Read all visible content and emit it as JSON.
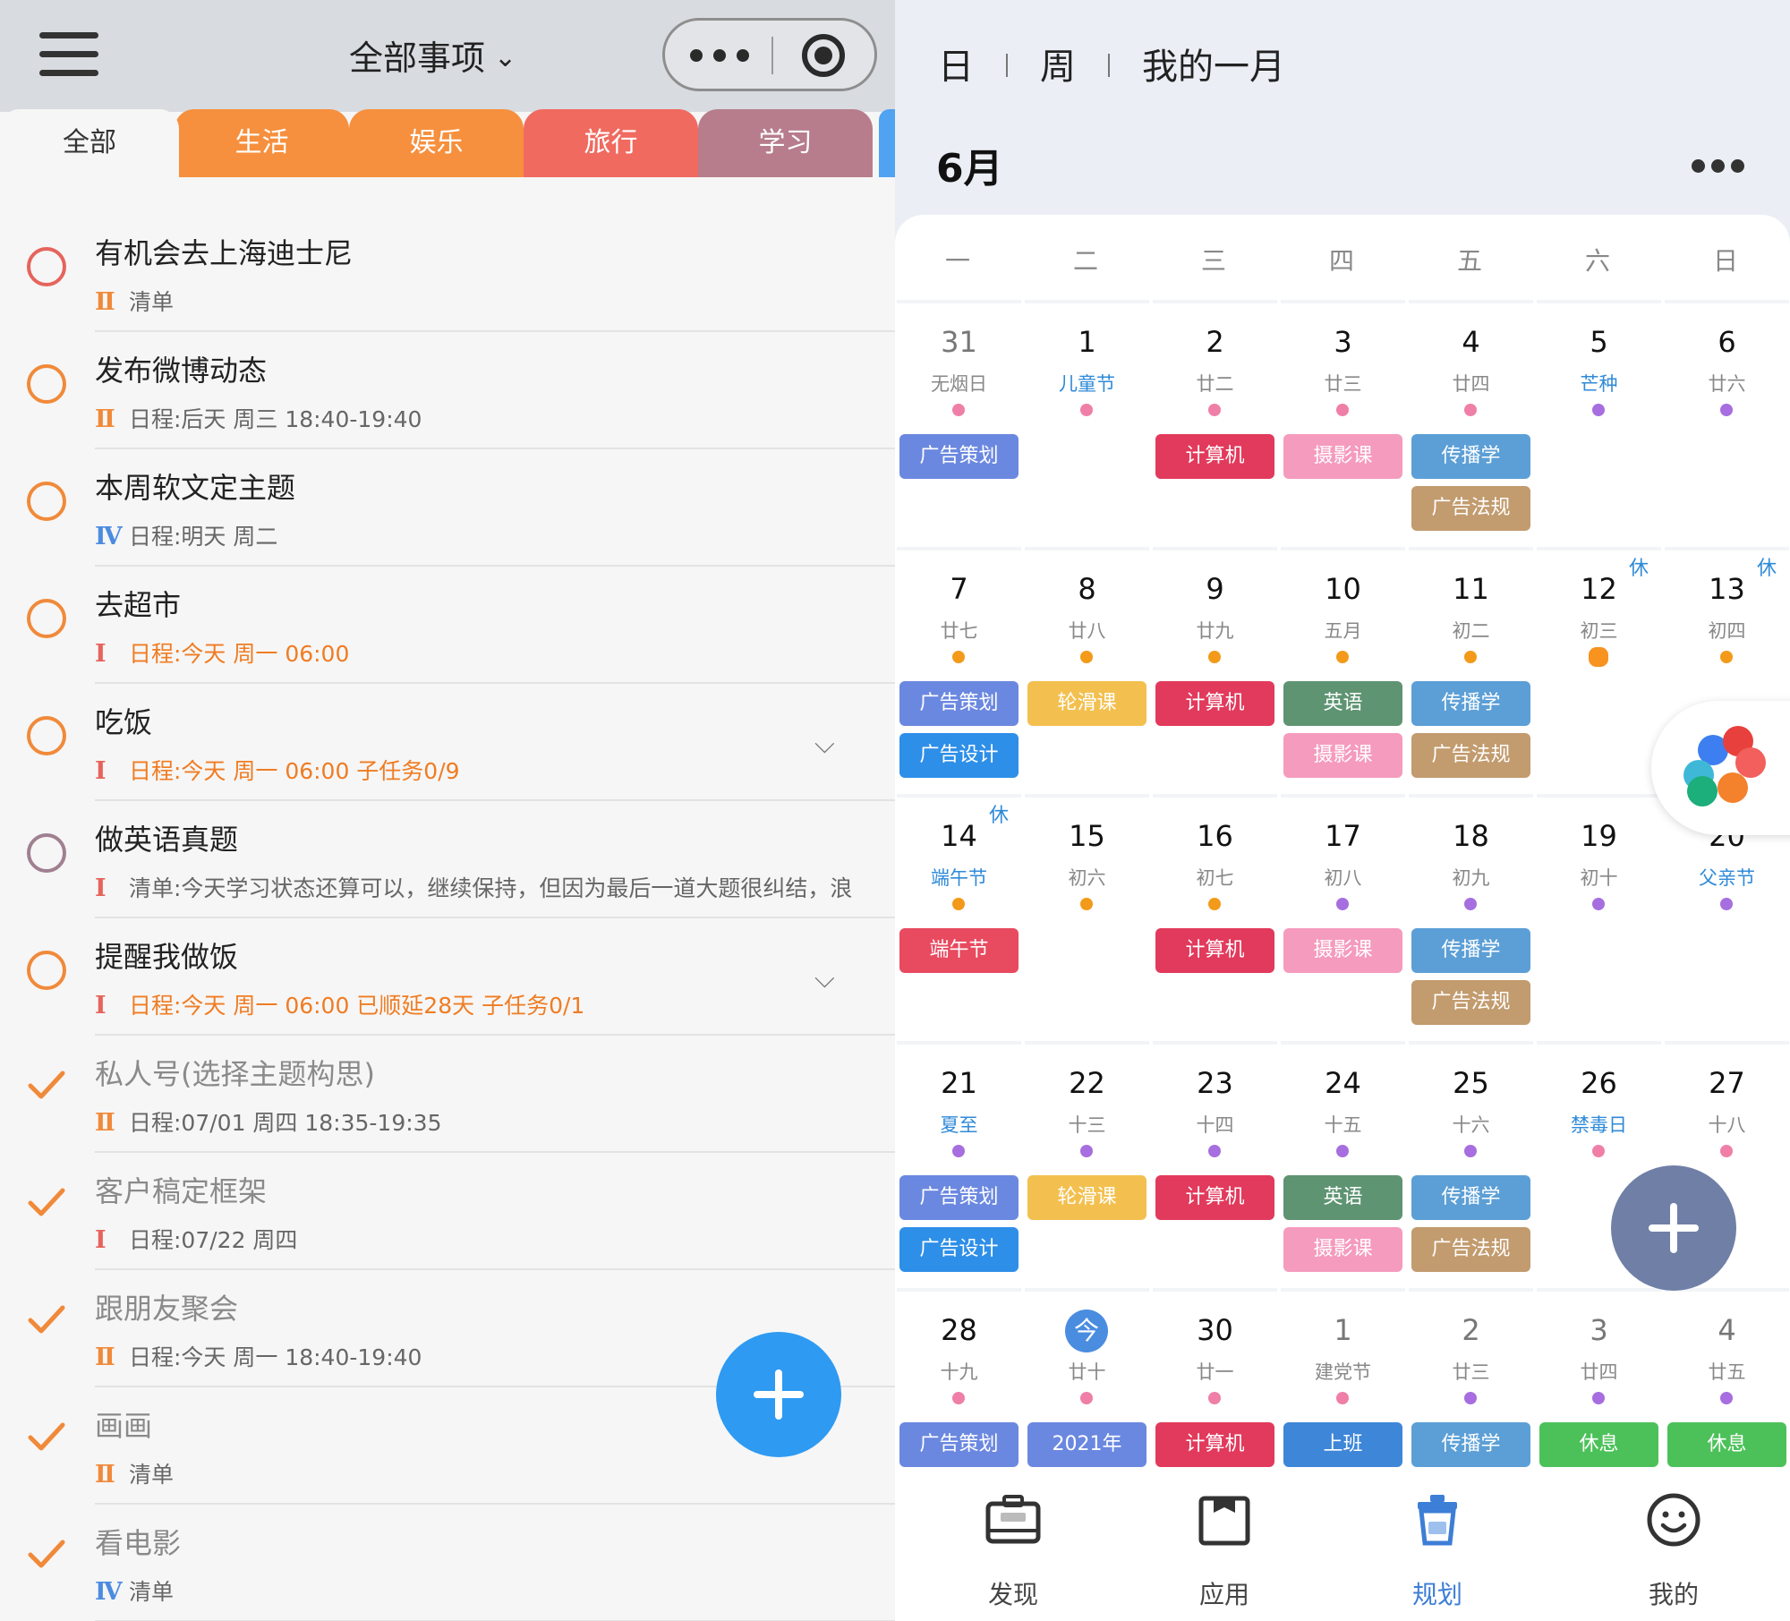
{
  "left": {
    "title": "全部事项",
    "tabs": [
      {
        "label": "全部",
        "color": "#f6f6f6"
      },
      {
        "label": "生活",
        "color": "#f6903e"
      },
      {
        "label": "娱乐",
        "color": "#f6903e"
      },
      {
        "label": "旅行",
        "color": "#f06a60"
      },
      {
        "label": "学习",
        "color": "#b77d8c"
      }
    ],
    "tasks": [
      {
        "title": "有机会去上海迪士尼",
        "prio": "Ⅱ",
        "sub": "清单",
        "done": false
      },
      {
        "title": "发布微博动态",
        "prio": "Ⅱ",
        "sub": "日程:后天 周三 18:40-19:40",
        "done": false
      },
      {
        "title": "本周软文定主题",
        "prio": "Ⅳ",
        "sub": "日程:明天 周二",
        "done": false
      },
      {
        "title": "去超市",
        "prio": "Ⅰ",
        "sub": "日程:今天 周一 06:00",
        "done": false
      },
      {
        "title": "吃饭",
        "prio": "Ⅰ",
        "sub": "日程:今天 周一 06:00 子任务0/9",
        "done": false
      },
      {
        "title": "做英语真题",
        "prio": "Ⅰ",
        "sub": "清单:今天学习状态还算可以，继续保持，但因为最后一道大题很纠结，浪",
        "done": false
      },
      {
        "title": "提醒我做饭",
        "prio": "Ⅰ",
        "sub": "日程:今天 周一 06:00 已顺延28天 子任务0/1",
        "done": false
      },
      {
        "title": "私人号(选择主题构思)",
        "prio": "Ⅱ",
        "sub": "日程:07/01 周四 18:35-19:35",
        "done": true
      },
      {
        "title": "客户稿定框架",
        "prio": "Ⅰ",
        "sub": "日程:07/22 周四",
        "done": true
      },
      {
        "title": "跟朋友聚会",
        "prio": "Ⅱ",
        "sub": "日程:今天 周一 18:40-19:40",
        "done": true
      },
      {
        "title": "画画",
        "prio": "Ⅱ",
        "sub": "清单",
        "done": true
      },
      {
        "title": "看电影",
        "prio": "Ⅳ",
        "sub": "清单",
        "done": true
      }
    ]
  },
  "right": {
    "views": [
      "日",
      "周",
      "我的一月"
    ],
    "month": "6月",
    "weekdays": [
      "一",
      "二",
      "三",
      "四",
      "五",
      "六",
      "日"
    ],
    "event_colors": {
      "广告策划": "#6b88e0",
      "计算机": "#e23a5c",
      "摄影课": "#f59bbd",
      "传播学": "#5c9fd6",
      "广告法规": "#c29b6e",
      "广告设计": "#2e8fe8",
      "轮滑课": "#f3c04f",
      "英语": "#5f9473",
      "端午节": "#e84a5f",
      "2021年": "#6b88e0",
      "上班": "#3d86d8",
      "休息": "#4cc15a"
    },
    "weeks": [
      [
        {
          "n": "31",
          "s": "无烟日",
          "dot": "pink",
          "grey": true,
          "ev": [
            "广告策划"
          ]
        },
        {
          "n": "1",
          "s": "儿童节",
          "hol": true,
          "dot": "pink",
          "ev": []
        },
        {
          "n": "2",
          "s": "廿二",
          "dot": "pink",
          "ev": [
            "计算机"
          ]
        },
        {
          "n": "3",
          "s": "廿三",
          "dot": "pink",
          "ev": [
            "摄影课"
          ]
        },
        {
          "n": "4",
          "s": "廿四",
          "dot": "pink",
          "ev": [
            "传播学",
            "广告法规"
          ]
        },
        {
          "n": "5",
          "s": "芒种",
          "hol": true,
          "dot": "purple",
          "ev": []
        },
        {
          "n": "6",
          "s": "廿六",
          "dot": "purple",
          "ev": []
        }
      ],
      [
        {
          "n": "7",
          "s": "廿七",
          "dot": "orange",
          "ev": [
            "广告策划",
            "广告设计"
          ]
        },
        {
          "n": "8",
          "s": "廿八",
          "dot": "orange",
          "ev": [
            "轮滑课"
          ]
        },
        {
          "n": "9",
          "s": "廿九",
          "dot": "orange",
          "ev": [
            "计算机"
          ]
        },
        {
          "n": "10",
          "s": "五月",
          "dot": "orange",
          "ev": [
            "英语",
            "摄影课"
          ]
        },
        {
          "n": "11",
          "s": "初二",
          "dot": "orange",
          "ev": [
            "传播学",
            "广告法规"
          ]
        },
        {
          "n": "12",
          "s": "初三",
          "dot": "flower",
          "rest": "休",
          "ev": []
        },
        {
          "n": "13",
          "s": "初四",
          "dot": "orange",
          "rest": "休",
          "ev": []
        }
      ],
      [
        {
          "n": "14",
          "s": "端午节",
          "hol": true,
          "dot": "orange",
          "rest": "休",
          "ev": [
            "端午节"
          ]
        },
        {
          "n": "15",
          "s": "初六",
          "dot": "orange",
          "ev": []
        },
        {
          "n": "16",
          "s": "初七",
          "dot": "orange",
          "ev": [
            "计算机"
          ]
        },
        {
          "n": "17",
          "s": "初八",
          "dot": "purple",
          "ev": [
            "摄影课"
          ]
        },
        {
          "n": "18",
          "s": "初九",
          "dot": "purple",
          "ev": [
            "传播学",
            "广告法规"
          ]
        },
        {
          "n": "19",
          "s": "初十",
          "dot": "purple",
          "ev": []
        },
        {
          "n": "20",
          "s": "父亲节",
          "hol": true,
          "dot": "purple",
          "ev": []
        }
      ],
      [
        {
          "n": "21",
          "s": "夏至",
          "hol": true,
          "dot": "purple",
          "ev": [
            "广告策划",
            "广告设计"
          ]
        },
        {
          "n": "22",
          "s": "十三",
          "dot": "purple",
          "ev": [
            "轮滑课"
          ]
        },
        {
          "n": "23",
          "s": "十四",
          "dot": "purple",
          "ev": [
            "计算机"
          ]
        },
        {
          "n": "24",
          "s": "十五",
          "dot": "purple",
          "ev": [
            "英语",
            "摄影课"
          ]
        },
        {
          "n": "25",
          "s": "十六",
          "dot": "purple",
          "ev": [
            "传播学",
            "广告法规"
          ]
        },
        {
          "n": "26",
          "s": "禁毒日",
          "hol": true,
          "dot": "pink",
          "ev": []
        },
        {
          "n": "27",
          "s": "十八",
          "dot": "pink",
          "ev": []
        }
      ],
      [
        {
          "n": "28",
          "s": "十九",
          "dot": "pink",
          "ev": [
            "广告策划"
          ]
        },
        {
          "n": "今",
          "s": "廿十",
          "today": true,
          "dot": "pink",
          "ev": [
            "2021年"
          ]
        },
        {
          "n": "30",
          "s": "廿一",
          "dot": "pink",
          "ev": [
            "计算机"
          ]
        },
        {
          "n": "1",
          "s": "建党节",
          "grey": true,
          "dot": "pink",
          "ev": [
            "上班"
          ]
        },
        {
          "n": "2",
          "s": "廿三",
          "grey": true,
          "dot": "purple",
          "ev": [
            "传播学"
          ]
        },
        {
          "n": "3",
          "s": "廿四",
          "grey": true,
          "dot": "purple",
          "ev": [
            "休息"
          ]
        },
        {
          "n": "4",
          "s": "廿五",
          "grey": true,
          "dot": "purple",
          "ev": [
            "休息"
          ]
        }
      ]
    ],
    "nav": [
      {
        "label": "发现",
        "icon": "briefcase-icon",
        "active": false
      },
      {
        "label": "应用",
        "icon": "folder-icon",
        "active": false
      },
      {
        "label": "规划",
        "icon": "trash-can-icon",
        "active": true
      },
      {
        "label": "我的",
        "icon": "smile-icon",
        "active": false
      }
    ]
  }
}
